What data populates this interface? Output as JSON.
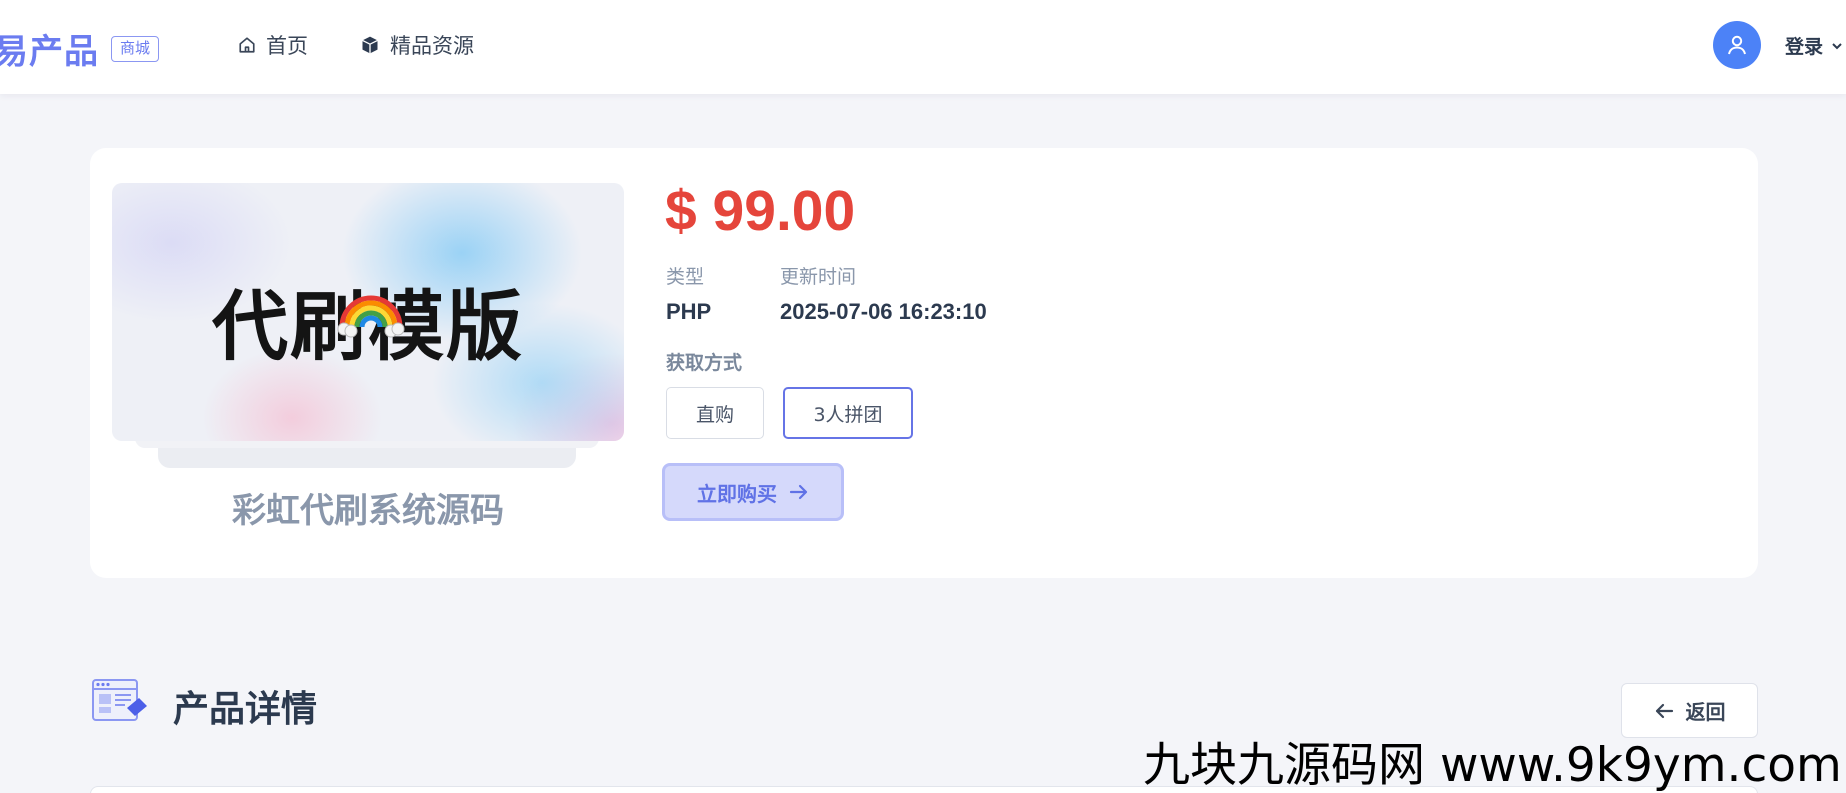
{
  "header": {
    "brand_name": "易产品",
    "brand_badge": "商城",
    "nav": [
      {
        "label": "首页",
        "icon": "home-icon"
      },
      {
        "label": "精品资源",
        "icon": "box-icon"
      }
    ],
    "avatar_icon": "user-icon",
    "login_label": "登录",
    "accent_color": "#6b7cf0"
  },
  "product": {
    "image_title": "代刷模版",
    "image_emoji": "rainbow-icon",
    "name": "彩虹代刷系统源码",
    "price": "$ 99.00",
    "price_color": "#e5453b",
    "meta": {
      "type_label": "类型",
      "type_value": "PHP",
      "updated_label": "更新时间",
      "updated_value": "2025-07-06 16:23:10"
    },
    "get_method_label": "获取方式",
    "options": [
      {
        "label": "直购",
        "selected": false
      },
      {
        "label": "3人拼团",
        "selected": true
      }
    ],
    "buy_label": "立即购买"
  },
  "details": {
    "title": "产品详情",
    "back_label": "返回"
  },
  "watermark": "九块九源码网 www.9k9ym.com"
}
